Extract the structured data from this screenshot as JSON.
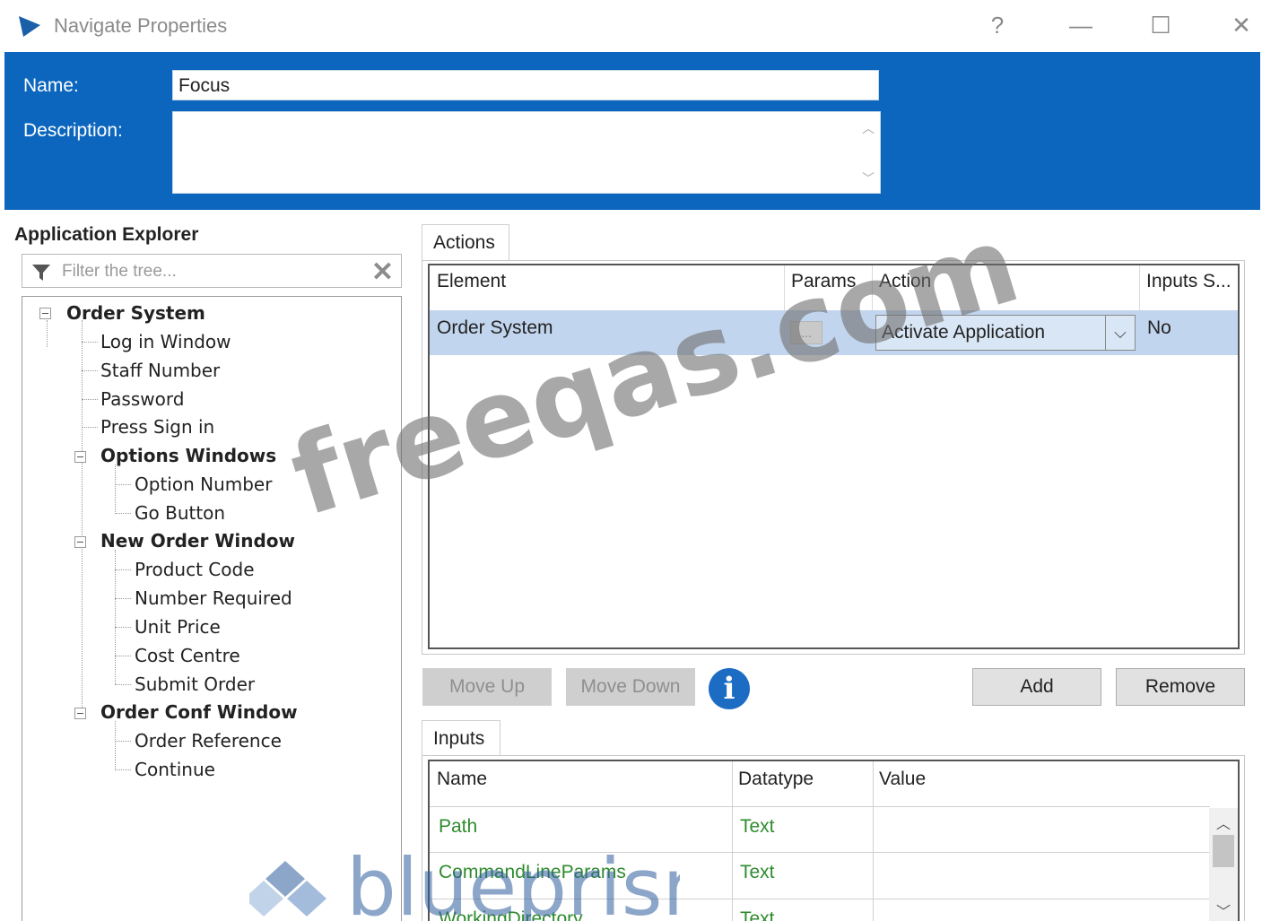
{
  "window": {
    "title": "Navigate Properties",
    "help_label": "?",
    "minimize_label": "—",
    "maximize_label": "☐",
    "close_label": "✕"
  },
  "header": {
    "name_label": "Name:",
    "name_value": "Focus",
    "description_label": "Description:",
    "description_value": ""
  },
  "explorer": {
    "title": "Application Explorer",
    "filter_placeholder": "Filter the tree...",
    "tree": {
      "root": "Order System",
      "n1": "Log in Window",
      "n2": "Staff Number",
      "n3": "Password",
      "n4": "Press Sign in",
      "n5": "Options Windows",
      "n6": "Option Number",
      "n7": "Go Button",
      "n8": "New Order Window",
      "n9": "Product Code",
      "n10": "Number Required",
      "n11": "Unit Price",
      "n12": "Cost Centre",
      "n13": "Submit Order",
      "n14": "Order Conf Window",
      "n15": "Order Reference",
      "n16": "Continue"
    }
  },
  "actions": {
    "tab_label": "Actions",
    "columns": {
      "element": "Element",
      "params": "Params",
      "action": "Action",
      "inputs": "Inputs S..."
    },
    "rows": [
      {
        "element": "Order System",
        "params": "...",
        "action": "Activate Application",
        "inputs": "No"
      }
    ]
  },
  "buttons": {
    "move_up": "Move Up",
    "move_down": "Move Down",
    "add": "Add",
    "remove": "Remove",
    "info_glyph": "i"
  },
  "inputs": {
    "tab_label": "Inputs",
    "columns": {
      "name": "Name",
      "datatype": "Datatype",
      "value": "Value"
    },
    "rows": [
      {
        "name": "Path",
        "datatype": "Text",
        "value": ""
      },
      {
        "name": "CommandLineParams",
        "datatype": "Text",
        "value": ""
      },
      {
        "name": "WorkingDirectory",
        "datatype": "Text",
        "value": ""
      }
    ]
  },
  "watermarks": {
    "site": "freeqas.com",
    "brand": "blueprism"
  },
  "colors": {
    "header_blue": "#0c66bd",
    "selected_row": "#c2d5ee",
    "input_text_green": "#2e8b2e",
    "info_blue": "#1c6cc4"
  }
}
